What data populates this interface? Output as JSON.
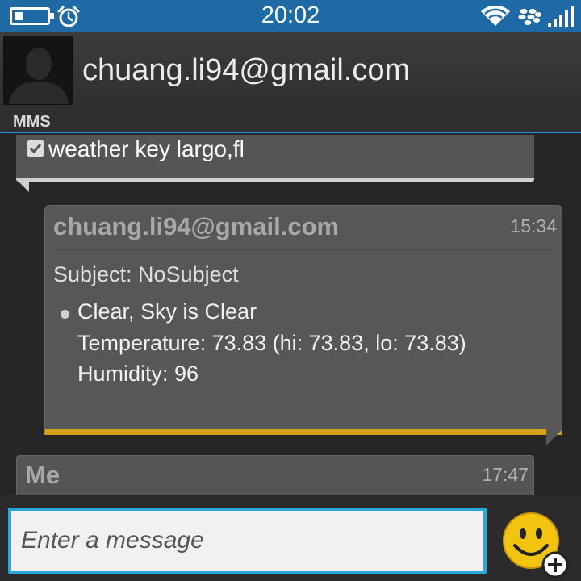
{
  "status_bar": {
    "time": "20:02",
    "icons": [
      "battery-icon",
      "alarm-clock-icon",
      "wifi-icon",
      "blackberry-messenger-icon",
      "signal-strength-icon"
    ]
  },
  "header": {
    "contact": "chuang.li94@gmail.com",
    "avatar_icon": "person-silhouette-icon"
  },
  "tab": {
    "label": "MMS"
  },
  "messages": [
    {
      "direction": "sent",
      "text": "weather key largo,fl",
      "icon": "checkmark-icon"
    },
    {
      "direction": "received",
      "sender": "chuang.li94@gmail.com",
      "time": "15:34",
      "subject": "Subject: NoSubject",
      "lines": [
        "Clear, Sky is Clear",
        "Temperature: 73.83 (hi: 73.83, lo: 73.83)",
        "Humidity: 96"
      ]
    },
    {
      "direction": "sent",
      "sender": "Me",
      "time": "17:47"
    }
  ],
  "composer": {
    "placeholder": "Enter a message",
    "emoji_icon": "smiley-add-icon"
  },
  "colors": {
    "status_bar": "#1f6aa5",
    "accent_blue": "#2f8fd0",
    "received_accent": "#d6a11a",
    "input_border": "#28a9dc",
    "emoji_yellow": "#f2c40f"
  }
}
